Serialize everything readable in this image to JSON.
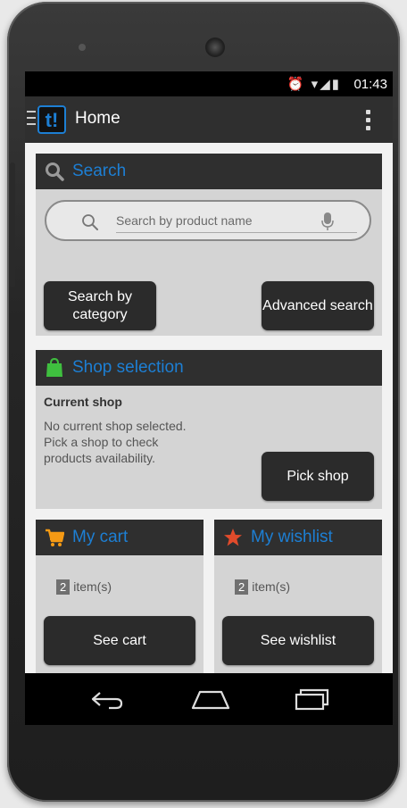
{
  "status_bar": {
    "icons": "⏰ ▾◢▮",
    "time": "01:43"
  },
  "app_bar": {
    "logo": "t!",
    "title": "Home"
  },
  "search_card": {
    "title": "Search",
    "placeholder": "Search by product name",
    "category_button": "Search by category",
    "advanced_button": "Advanced search"
  },
  "shop_card": {
    "title": "Shop selection",
    "current_label": "Current shop",
    "description": "No current shop selected. Pick a shop to check products availability.",
    "pick_button": "Pick shop"
  },
  "cart_card": {
    "title": "My cart",
    "count": "2",
    "count_suffix": "item(s)",
    "button": "See cart"
  },
  "wishlist_card": {
    "title": "My wishlist",
    "count": "2",
    "count_suffix": "item(s)",
    "button": "See wishlist"
  },
  "colors": {
    "accent": "#1d7fd4",
    "card_header": "#2f2f2f",
    "card_body": "#d4d4d4",
    "cart_icon": "#f59a14",
    "star_icon": "#e14b2b",
    "shop_icon": "#3fbf3f"
  }
}
